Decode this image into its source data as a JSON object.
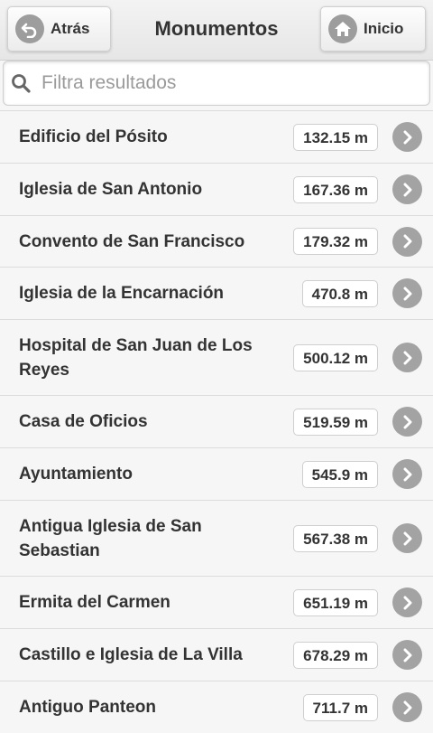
{
  "header": {
    "title": "Monumentos",
    "back_label": "Atrás",
    "home_label": "Inicio"
  },
  "search": {
    "placeholder": "Filtra resultados",
    "value": ""
  },
  "monuments": [
    {
      "name": "Edificio del Pósito",
      "distance": "132.15 m"
    },
    {
      "name": "Iglesia de San Antonio",
      "distance": "167.36 m"
    },
    {
      "name": "Convento de San Francisco",
      "distance": "179.32 m"
    },
    {
      "name": "Iglesia de la Encarnación",
      "distance": "470.8 m"
    },
    {
      "name": "Hospital de San Juan de Los Reyes",
      "distance": "500.12 m"
    },
    {
      "name": "Casa de Oficios",
      "distance": "519.59 m"
    },
    {
      "name": "Ayuntamiento",
      "distance": "545.9 m"
    },
    {
      "name": "Antigua Iglesia de San Sebastian",
      "distance": "567.38 m"
    },
    {
      "name": "Ermita del Carmen",
      "distance": "651.19 m"
    },
    {
      "name": "Castillo e Iglesia de La Villa",
      "distance": "678.29 m"
    },
    {
      "name": "Antiguo Panteon",
      "distance": "711.7 m"
    }
  ]
}
